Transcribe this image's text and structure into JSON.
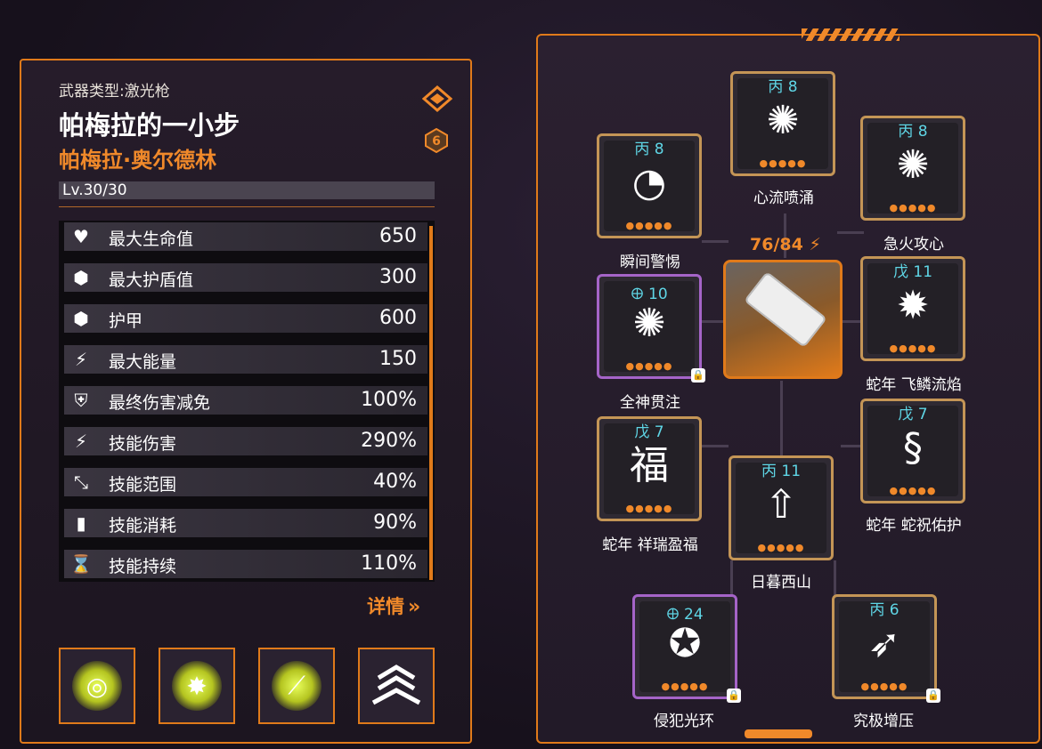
{
  "weapon": {
    "type_label": "武器类型:激光枪",
    "name": "帕梅拉的一小步",
    "owner": "帕梅拉·奥尔德林",
    "level": "Lv.30/30",
    "rank_badge": "6"
  },
  "stats": [
    {
      "icon": "heart-icon",
      "label": "最大生命值",
      "value": "650"
    },
    {
      "icon": "hexagon-shield-icon",
      "label": "最大护盾值",
      "value": "300"
    },
    {
      "icon": "hexagon-armor-icon",
      "label": "护甲",
      "value": "600"
    },
    {
      "icon": "lightning-icon",
      "label": "最大能量",
      "value": "150"
    },
    {
      "icon": "shield-plus-icon",
      "label": "最终伤害减免",
      "value": "100%"
    },
    {
      "icon": "skill-damage-icon",
      "label": "技能伤害",
      "value": "290%"
    },
    {
      "icon": "skill-range-icon",
      "label": "技能范围",
      "value": "40%"
    },
    {
      "icon": "battery-icon",
      "label": "技能消耗",
      "value": "90%"
    },
    {
      "icon": "hourglass-icon",
      "label": "技能持续",
      "value": "110%"
    }
  ],
  "details_label": "详情",
  "skill_buttons": [
    "orbit-skill-icon",
    "burst-skill-icon",
    "slash-skill-icon",
    "rank-chevron-icon"
  ],
  "energy_readout": "76/84",
  "nodes": [
    {
      "key": "n1",
      "tag": "丙 8",
      "label": "心流喷涌",
      "glyph": "spider-icon"
    },
    {
      "key": "n2",
      "tag": "丙 8",
      "label": "瞬间警惕",
      "glyph": "dial-icon"
    },
    {
      "key": "n3",
      "tag": "丙 8",
      "label": "急火攻心",
      "glyph": "spider-icon"
    },
    {
      "key": "n4",
      "tag": "🜨 10",
      "label": "全神贯注",
      "glyph": "spider-icon"
    },
    {
      "key": "n5",
      "tag": "戊 11",
      "label": "蛇年 飞鳞流焰",
      "glyph": "firework-icon"
    },
    {
      "key": "n6",
      "tag": "戊 7",
      "label": "蛇年 祥瑞盈福",
      "glyph": "fortune-bag-icon"
    },
    {
      "key": "n7",
      "tag": "戊 7",
      "label": "蛇年 蛇祝佑护",
      "glyph": "snake-icon"
    },
    {
      "key": "n8",
      "tag": "丙 11",
      "label": "日暮西山",
      "glyph": "rocket-icon"
    },
    {
      "key": "n9",
      "tag": "🜨 24",
      "label": "侵犯光环",
      "glyph": "star-circle-icon"
    },
    {
      "key": "n10",
      "tag": "丙 6",
      "label": "究极增压",
      "glyph": "arrow-burst-icon"
    }
  ]
}
